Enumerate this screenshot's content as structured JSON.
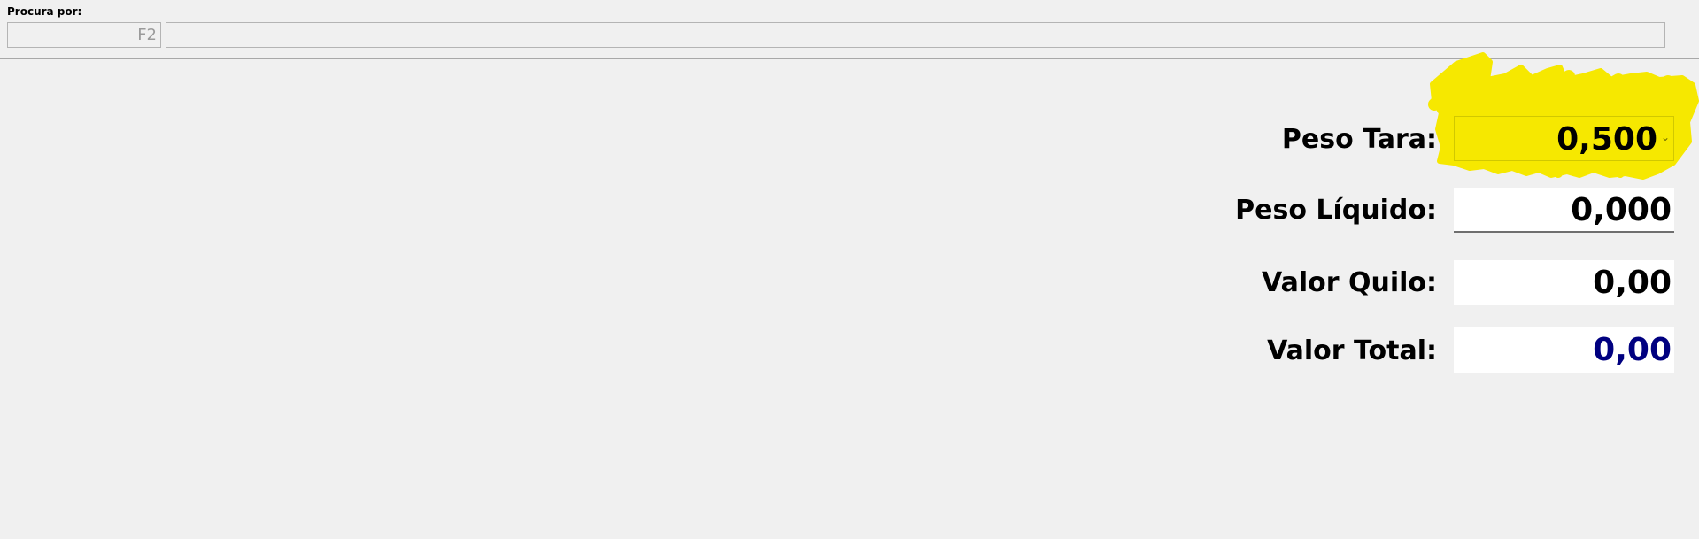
{
  "search": {
    "label": "Procura por:",
    "code_placeholder": "F2",
    "code_value": "",
    "description_value": ""
  },
  "fields": {
    "peso_tara": {
      "label": "Peso Tara:",
      "value": "0,500"
    },
    "peso_liquido": {
      "label": "Peso Líquido:",
      "value": "0,000"
    },
    "valor_quilo": {
      "label": "Valor Quilo:",
      "value": "0,00"
    },
    "valor_total": {
      "label": "Valor Total:",
      "value": "0,00"
    }
  },
  "icons": {
    "tara_dropdown": "chevron-down-icon"
  },
  "colors": {
    "background": "#f0f0f0",
    "highlight": "#f6e800",
    "total_value": "#000080",
    "field_background": "#ffffff"
  }
}
